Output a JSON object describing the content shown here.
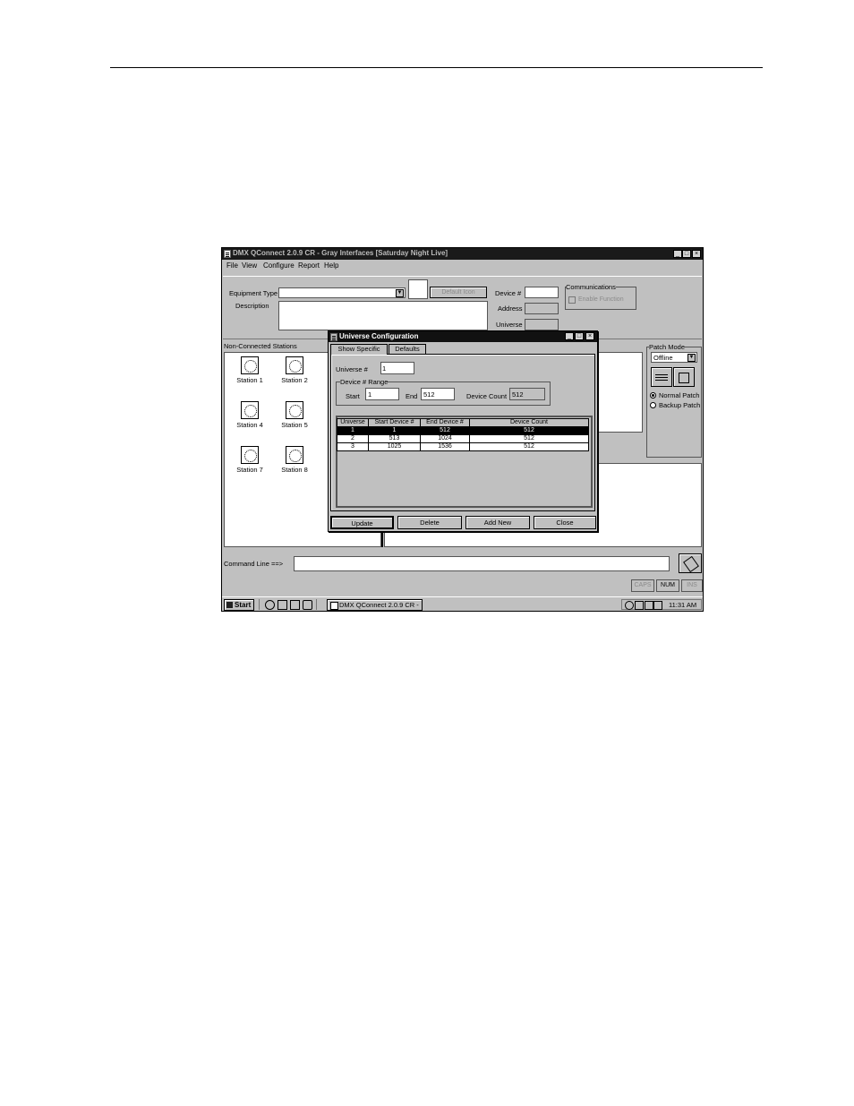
{
  "app": {
    "title": "DMX QConnect 2.0.9 CR - Gray Interfaces [Saturday Night Live]"
  },
  "menu": [
    "File",
    "View",
    "Configure",
    "Report",
    "Help"
  ],
  "equipment": {
    "type_label": "Equipment Type",
    "type_value": "",
    "description_label": "Description",
    "default_icon_label": "Default Icon",
    "device_label": "Device #",
    "address_label": "Address",
    "universe_label": "Universe",
    "communications_label": "Communications",
    "enable_label": "Enable Function"
  },
  "stations_panel": {
    "label": "Non-Connected Stations",
    "stations": [
      "Station 1",
      "Station 2",
      "Station 4",
      "Station 5",
      "Station 7",
      "Station 8"
    ]
  },
  "patch_mode": {
    "label": "Patch Mode",
    "selected": "Offline",
    "normal_label": "Normal Patch",
    "backup_label": "Backup Patch",
    "selected_radio": "Normal Patch"
  },
  "dialog": {
    "title": "Universe Configuration",
    "tabs": [
      "Show Specific",
      "Defaults"
    ],
    "universe_label": "Universe #",
    "universe_value": "1",
    "range_label": "Device # Range",
    "start_label": "Start",
    "start_value": "1",
    "end_label": "End",
    "end_value": "512",
    "count_label": "Device Count",
    "count_value": "512",
    "columns": [
      "Universe",
      "Start Device #",
      "End Device #",
      "Device Count"
    ],
    "rows": [
      [
        "1",
        "1",
        "512",
        "512"
      ],
      [
        "2",
        "513",
        "1024",
        "512"
      ],
      [
        "3",
        "1025",
        "1536",
        "512"
      ]
    ],
    "selected_row": 0,
    "buttons": [
      "Update",
      "Delete",
      "Add New",
      "Close"
    ]
  },
  "command_line": {
    "label": "Command Line ==>",
    "value": ""
  },
  "status": [
    "CAPS",
    "NUM",
    "INS"
  ],
  "taskbar": {
    "start": "Start",
    "task": "DMX QConnect 2.0.9 CR -",
    "clock": "11:31 AM"
  }
}
